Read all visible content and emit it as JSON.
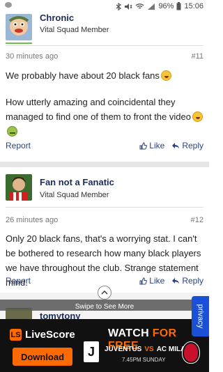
{
  "statusbar": {
    "battery": "96%",
    "time": "15:06"
  },
  "posts": [
    {
      "author": "Chronic",
      "role": "Vital Squad Member",
      "time": "30 minutes ago",
      "number": "#11",
      "paragraph1": "We probably have about 20 black fans",
      "paragraph2": "How utterly amazing and coincidental they managed to find one of them to front the video",
      "report": "Report",
      "like": "Like",
      "reply": "Reply"
    },
    {
      "author": "Fan not a Fanatic",
      "role": "Vital Squad Member",
      "time": "26 minutes ago",
      "number": "#12",
      "paragraph1": "Only 20 black fans, that's a worrying stat. I can't be bothered to research how many black players we have throughout the club. Strange statement mind.",
      "report": "Report",
      "like": "Like",
      "reply": "Reply"
    },
    {
      "author": "tomytony"
    }
  ],
  "swipe": {
    "label": "Swipe to See More"
  },
  "privacy": {
    "label": "privacy"
  },
  "ad": {
    "brand": "LiveScore",
    "download": "Download",
    "watch": "WATCH",
    "for_free": "FOR FREE",
    "home": "JUVENTUS",
    "vs": "VS",
    "away": "AC MILAN",
    "time": "7.45PM SUNDAY"
  },
  "colors": {
    "accent": "#1c2b59",
    "link": "#2a4480",
    "live_orange": "#ff6a00",
    "badge_green": "#6cc24a"
  }
}
